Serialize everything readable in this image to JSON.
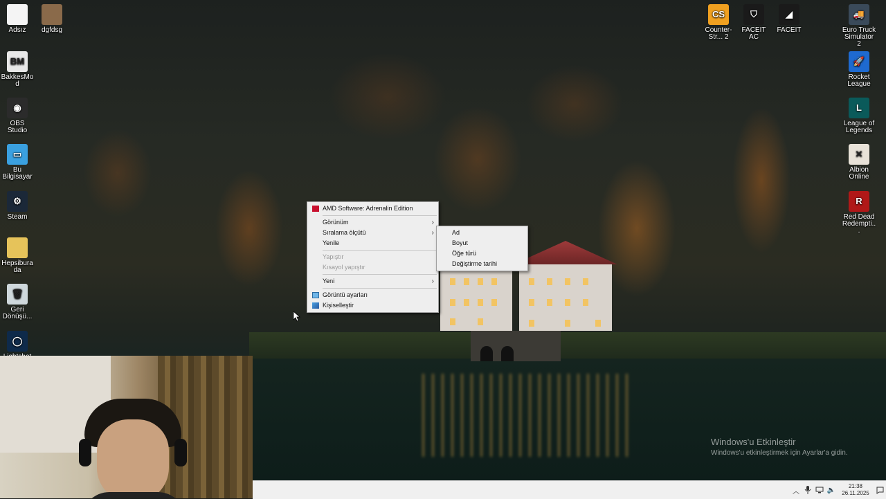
{
  "desktop": {
    "left_icons": [
      {
        "label": "Adsız",
        "icon": "document-icon",
        "bg": "#f4f4f4",
        "glyph": ""
      },
      {
        "label": "BakkesMod",
        "icon": "bakkesmod-icon",
        "bg": "#e8e8e8",
        "glyph": "BM"
      },
      {
        "label": "OBS Studio",
        "icon": "obs-icon",
        "bg": "#2b2b2b",
        "glyph": "◉"
      },
      {
        "label": "Bu Bilgisayar",
        "icon": "computer-icon",
        "bg": "#3aa0e0",
        "glyph": "▭"
      },
      {
        "label": "Steam",
        "icon": "steam-icon",
        "bg": "#1b2838",
        "glyph": "⚙"
      },
      {
        "label": "Hepsiburada",
        "icon": "folder-icon",
        "bg": "#e6c35a",
        "glyph": ""
      },
      {
        "label": "Geri Dönüşü...",
        "icon": "recycle-bin-icon",
        "bg": "#cfd8dc",
        "glyph": "🗑"
      },
      {
        "label": "Lightshot",
        "icon": "app-icon",
        "bg": "#0e2a4a",
        "glyph": "◯"
      }
    ],
    "second_column": [
      {
        "label": "dgfdsg",
        "icon": "image-file-icon",
        "bg": "#8a6a4a",
        "glyph": ""
      }
    ],
    "top_icons": [
      {
        "label": "Counter-Str... 2",
        "icon": "counter-strike-icon",
        "bg": "#f0a020",
        "glyph": "CS"
      },
      {
        "label": "FACEIT AC",
        "icon": "faceit-ac-icon",
        "bg": "#1a1a1a",
        "glyph": "⛉"
      },
      {
        "label": "FACEIT",
        "icon": "faceit-icon",
        "bg": "#1a1a1a",
        "glyph": "◢"
      }
    ],
    "right_icons": [
      {
        "label": "Euro Truck Simulator 2",
        "icon": "euro-truck-icon",
        "bg": "#3a4a5a",
        "glyph": "🚚"
      },
      {
        "label": "Rocket League",
        "icon": "rocket-league-icon",
        "bg": "#1e6ad0",
        "glyph": "🚀"
      },
      {
        "label": "League of Legends",
        "icon": "league-of-legends-icon",
        "bg": "#0a5a5a",
        "glyph": "L"
      },
      {
        "label": "Albion Online",
        "icon": "albion-online-icon",
        "bg": "#e8e2d8",
        "glyph": "✕"
      },
      {
        "label": "Red Dead Redempti...",
        "icon": "red-dead-icon",
        "bg": "#b01818",
        "glyph": "R"
      }
    ]
  },
  "context_menu": {
    "amd": "AMD Software: Adrenalin Edition",
    "view": "Görünüm",
    "sort_by": "Sıralama ölçütü",
    "refresh": "Yenile",
    "paste": "Yapıştır",
    "paste_shortcut": "Kısayol yapıştır",
    "new": "Yeni",
    "display_settings": "Görüntü ayarları",
    "personalize": "Kişiselleştir"
  },
  "sort_submenu": {
    "items": [
      "Ad",
      "Boyut",
      "Öğe türü",
      "Değiştirme tarihi"
    ]
  },
  "watermark": {
    "title": "Windows'u Etkinleştir",
    "subtitle": "Windows'u etkinleştirmek için Ayarlar'a gidin."
  },
  "taskbar": {
    "time": "21:38",
    "date": "26.11.2025"
  },
  "colors": {
    "menu_bg": "#eeeeee",
    "taskbar_bg": "#f0f0f0",
    "amd_red": "#c8102e"
  }
}
